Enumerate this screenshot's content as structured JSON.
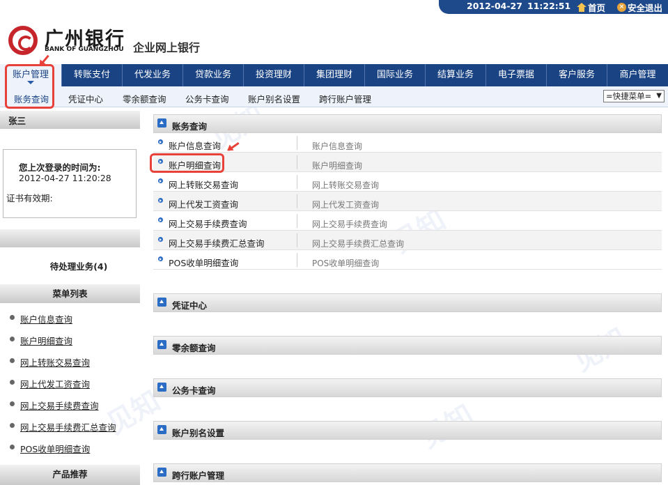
{
  "topbar": {
    "date": "2012-04-27",
    "time": "11:22:51",
    "home": "首页",
    "logout": "安全退出"
  },
  "header": {
    "bank_cn": "广州银行",
    "bank_en": "BANK OF GUANGZHOU",
    "ebank": "企业网上银行"
  },
  "mainnav": [
    "账户管理",
    "转账支付",
    "代发业务",
    "贷款业务",
    "投资理财",
    "集团理财",
    "国际业务",
    "结算业务",
    "电子票据",
    "客户服务",
    "商户管理"
  ],
  "subnav": [
    "账务查询",
    "凭证中心",
    "零余额查询",
    "公务卡查询",
    "账户别名设置",
    "跨行账户管理"
  ],
  "quickmenu": "=快捷菜单=",
  "sidebar": {
    "username": "张三",
    "last_login_label": "您上次登录的时间为:",
    "last_login_time": "2012-04-27 11:20:28",
    "cert_validity": "证书有效期:",
    "pending": "待处理业务(4)",
    "menu_title": "菜单列表",
    "menu_items": [
      "账户信息查询",
      "账户明细查询",
      "网上转账交易查询",
      "网上代发工资查询",
      "网上交易手续费查询",
      "网上交易手续费汇总查询",
      "POS收单明细查询"
    ],
    "product_title": "产品推荐"
  },
  "content": {
    "section1": "账务查询",
    "rows": [
      {
        "name": "账户信息查询",
        "desc": "账户信息查询"
      },
      {
        "name": "账户明细查询",
        "desc": "账户明细查询"
      },
      {
        "name": "网上转账交易查询",
        "desc": "网上转账交易查询"
      },
      {
        "name": "网上代发工资查询",
        "desc": "网上代发工资查询"
      },
      {
        "name": "网上交易手续费查询",
        "desc": "网上交易手续费查询"
      },
      {
        "name": "网上交易手续费汇总查询",
        "desc": "网上交易手续费汇总查询"
      },
      {
        "name": "POS收单明细查询",
        "desc": "POS收单明细查询"
      }
    ],
    "sections": [
      "凭证中心",
      "零余额查询",
      "公务卡查询",
      "账户别名设置",
      "跨行账户管理"
    ]
  },
  "colors": {
    "nav_blue": "#1a4384",
    "accent_red": "#c6262b",
    "highlight": "#e8413a"
  }
}
